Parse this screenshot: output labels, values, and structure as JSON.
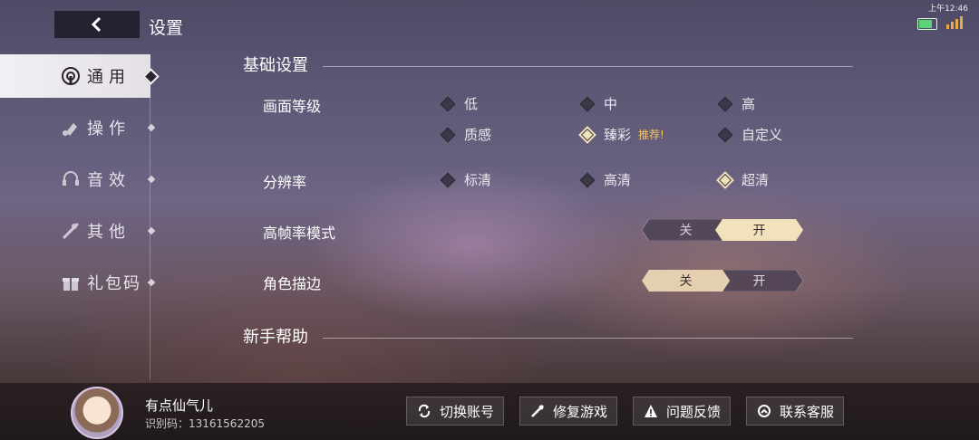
{
  "status": {
    "time": "上午12:46"
  },
  "header": {
    "title": "设置"
  },
  "sidebar": {
    "items": [
      {
        "label": "通用",
        "icon": "general-icon",
        "active": true
      },
      {
        "label": "操作",
        "icon": "operation-icon",
        "active": false
      },
      {
        "label": "音效",
        "icon": "headset-icon",
        "active": false
      },
      {
        "label": "其他",
        "icon": "tools-icon",
        "active": false
      },
      {
        "label": "礼包码",
        "icon": "gift-icon",
        "active": false
      }
    ]
  },
  "main": {
    "section_basic": "基础设置",
    "section_help": "新手帮助",
    "quality": {
      "label": "画面等级",
      "options": [
        "低",
        "中",
        "高",
        "质感",
        "臻彩",
        "自定义"
      ],
      "selected": "臻彩",
      "recommend_badge": "推荐!"
    },
    "resolution": {
      "label": "分辨率",
      "options": [
        "标清",
        "高清",
        "超清"
      ],
      "selected": "超清"
    },
    "high_fps": {
      "label": "高帧率模式",
      "off": "关",
      "on": "开",
      "value": "开"
    },
    "outline": {
      "label": "角色描边",
      "off": "关",
      "on": "开",
      "value": "关"
    }
  },
  "user": {
    "name": "有点仙气儿",
    "id_text": "识别码：13161562205"
  },
  "footer_buttons": [
    {
      "label": "切换账号",
      "icon": "switch-account-icon"
    },
    {
      "label": "修复游戏",
      "icon": "repair-icon"
    },
    {
      "label": "问题反馈",
      "icon": "warning-icon"
    },
    {
      "label": "联系客服",
      "icon": "customer-service-icon"
    }
  ],
  "colors": {
    "accent": "#f2e2bc",
    "badge": "#f2c560",
    "active_tab": "#f2f0f4"
  }
}
